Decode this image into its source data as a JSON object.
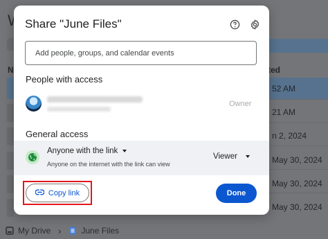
{
  "background": {
    "page_title_fragment": "W",
    "name_header_fragment": "N",
    "date_header_fragment": "ted",
    "dates": [
      "52 AM",
      "21 AM",
      "n 2, 2024",
      "May 30, 2024",
      "May 30, 2024",
      "May 30, 2024"
    ]
  },
  "dialog": {
    "title": "Share \"June Files\"",
    "help_icon": "help-circle-icon",
    "settings_icon": "gear-icon",
    "add_people_placeholder": "Add people, groups, and calendar events",
    "people_section_title": "People with access",
    "owner_role": "Owner",
    "general_section_title": "General access",
    "general_access": {
      "scope": "Anyone with the link",
      "description": "Anyone on the internet with the link can view",
      "role": "Viewer"
    },
    "copy_link_label": "Copy link",
    "done_label": "Done"
  },
  "breadcrumb": {
    "root": "My Drive",
    "current": "June Files"
  },
  "colors": {
    "accent": "#0b57d0",
    "highlight": "#e3161b",
    "globe_bg": "#c6eac8"
  }
}
